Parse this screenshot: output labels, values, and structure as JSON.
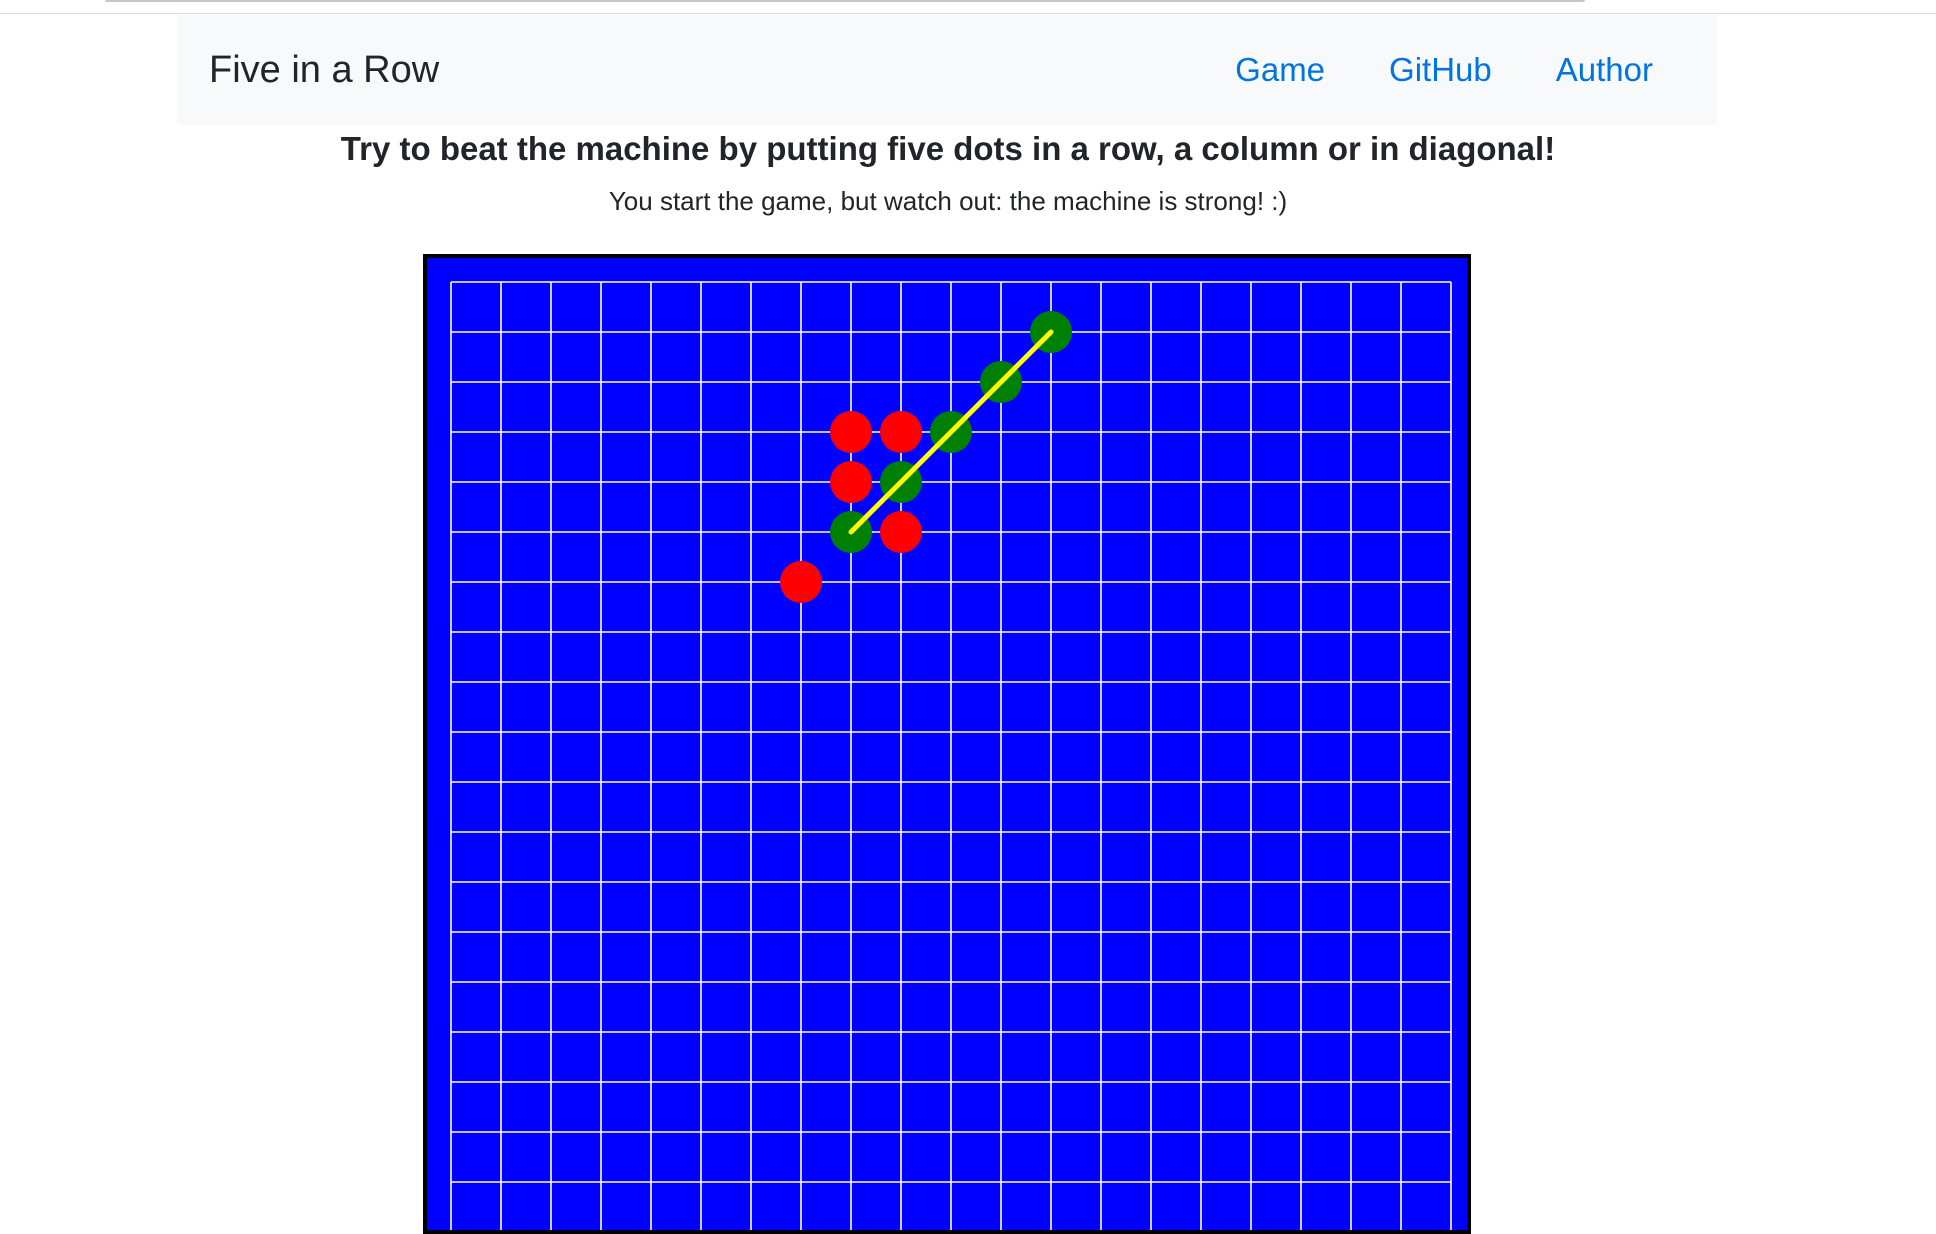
{
  "navbar": {
    "brand": "Five in a Row",
    "links": [
      "Game",
      "GitHub",
      "Author"
    ]
  },
  "intro": {
    "headline": "Try to beat the machine by putting five dots in a row, a column or in diagonal!",
    "subline": "You start the game, but watch out: the machine is strong! :)"
  },
  "colors": {
    "board": "#0000ff",
    "grid": "#ffffff",
    "frame": "#000000",
    "player_stone": "#ff0000",
    "machine_stone": "#008000",
    "win_line": "#ffff00",
    "link": "#0074e0"
  },
  "board": {
    "visible_rows": 19,
    "columns": 20,
    "red_stones": [
      [
        8,
        3
      ],
      [
        9,
        3
      ],
      [
        8,
        4
      ],
      [
        9,
        5
      ],
      [
        7,
        6
      ]
    ],
    "green_stones": [
      [
        12,
        1
      ],
      [
        11,
        2
      ],
      [
        10,
        3
      ],
      [
        9,
        4
      ],
      [
        8,
        5
      ]
    ],
    "winning_line": {
      "from": [
        8,
        5
      ],
      "to": [
        12,
        1
      ]
    }
  }
}
